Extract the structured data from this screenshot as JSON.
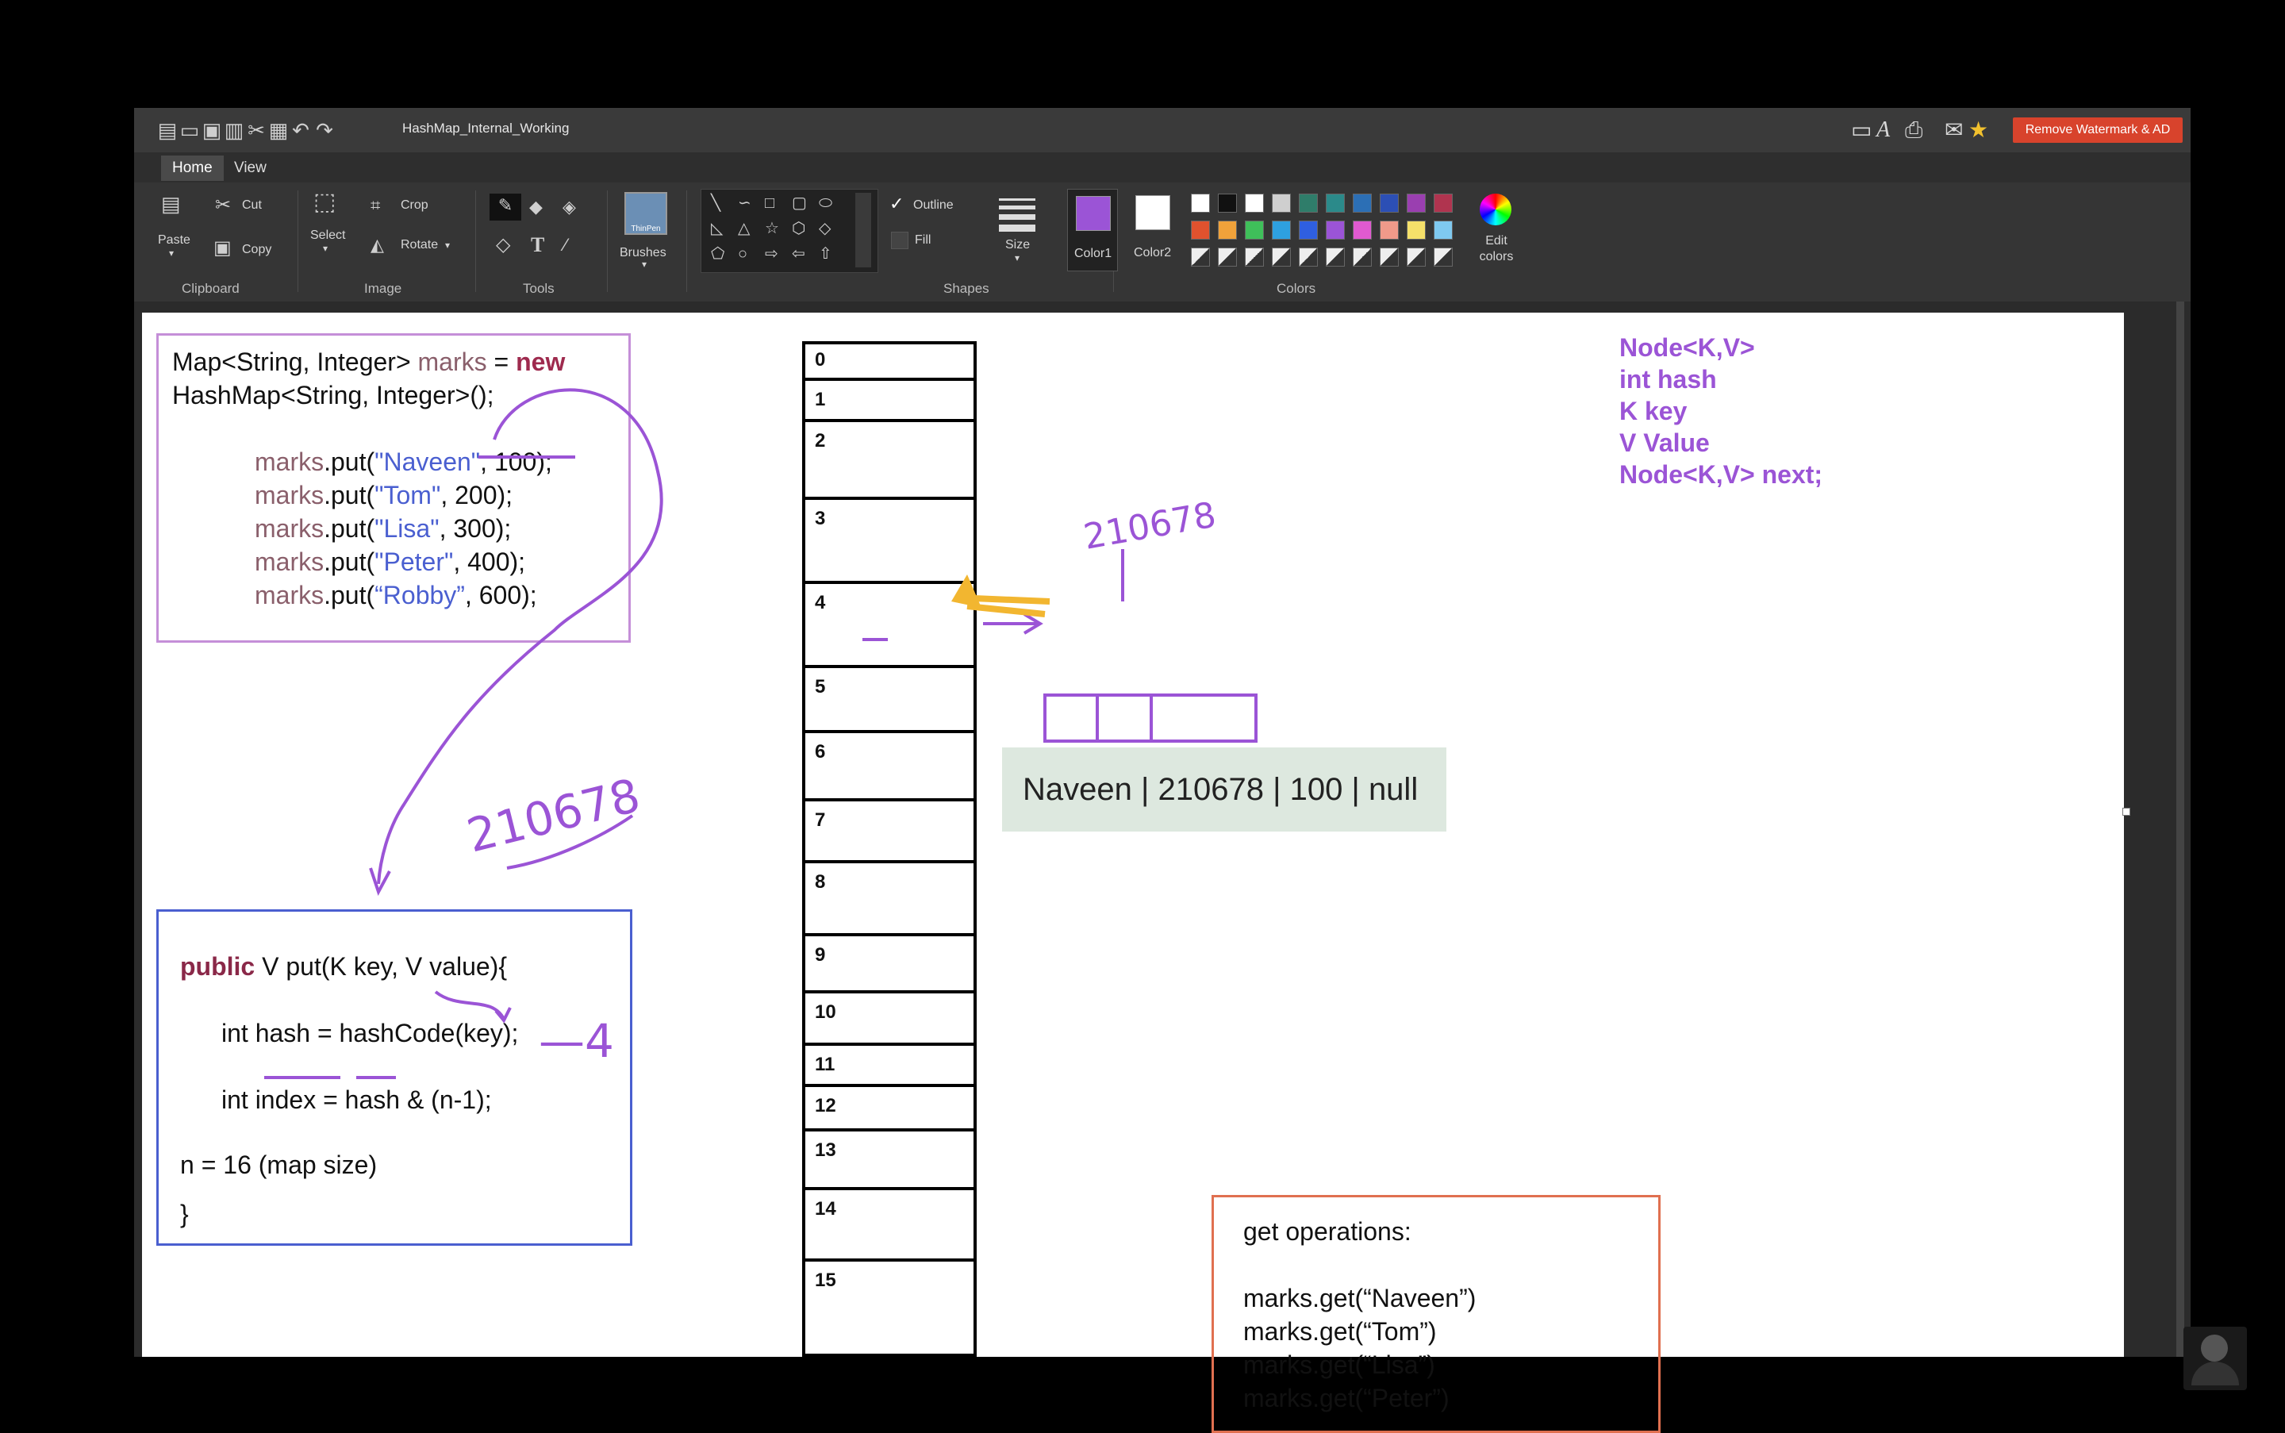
{
  "window": {
    "title": "HashMap_Internal_Working",
    "remove_watermark": "Remove Watermark & AD"
  },
  "tabs": [
    {
      "label": "Home",
      "active": true
    },
    {
      "label": "View",
      "active": false
    }
  ],
  "ribbon": {
    "clipboard": {
      "group": "Clipboard",
      "paste": "Paste",
      "cut": "Cut",
      "copy": "Copy"
    },
    "image": {
      "group": "Image",
      "select": "Select",
      "crop": "Crop",
      "rotate": "Rotate"
    },
    "tools": {
      "group": "Tools"
    },
    "brushes": {
      "label": "Brushes",
      "thumb": "ThinPen"
    },
    "shapes": {
      "group": "Shapes",
      "outline": "Outline",
      "fill": "Fill"
    },
    "size": {
      "label": "Size"
    },
    "colors": {
      "group": "Colors",
      "color1": "Color1",
      "color2": "Color2",
      "edit": "Edit colors",
      "color1_value": "#9b54d6",
      "color2_value": "#ffffff",
      "row1": [
        "#ffffff",
        "#111111",
        "#ffffff",
        "#cfcfcf",
        "#2f7d6a",
        "#2b8a8a",
        "#2c6fb5",
        "#2c4fb5",
        "#9a3fb0",
        "#b0344f"
      ],
      "row2": [
        "#e0522e",
        "#f0a23a",
        "#3fbf5a",
        "#2ea0e0",
        "#2f5fe0",
        "#9b54d6",
        "#e05ad0",
        "#f09a8a",
        "#f5e06a",
        "#7fc9f0"
      ]
    }
  },
  "code1": {
    "line1_a": "Map<String, Integer> ",
    "line1_b": "marks",
    "line1_c": " = ",
    "line1_d": "new",
    "line2": "HashMap<String, Integer>();",
    "puts": [
      {
        "obj": "marks",
        "pre": ".put(",
        "key": "\"Naveen\"",
        "post": ", 100);"
      },
      {
        "obj": "marks",
        "pre": ".put(",
        "key": "\"Tom\"",
        "post": ", 200);"
      },
      {
        "obj": "marks",
        "pre": ".put(",
        "key": "\"Lisa\"",
        "post": ", 300);"
      },
      {
        "obj": "marks",
        "pre": ".put(",
        "key": "\"Peter\"",
        "post": ", 400);"
      },
      {
        "obj": "marks",
        "pre": ".put(",
        "key": "“Robby”",
        "post": ", 600);"
      }
    ]
  },
  "code2": {
    "sig_kw": "public",
    "sig_rest": " V put(K key, V value){",
    "hash_line": "int hash = hashCode(key);",
    "index_line": "int index = hash & (n-1);",
    "n_line": "n = 16 (map size)",
    "close": "}"
  },
  "buckets": [
    "0",
    "1",
    "2",
    "3",
    "4",
    "5",
    "6",
    "7",
    "8",
    "9",
    "10",
    "11",
    "12",
    "13",
    "14",
    "15"
  ],
  "node_label": "Naveen | 210678 | 100 | null",
  "node_struct": [
    "Node<K,V>",
    "int hash",
    "K key",
    "V Value",
    "Node<K,V> next;"
  ],
  "get_ops": {
    "title": "get operations:",
    "lines": [
      "marks.get(“Naveen”)",
      "marks.get(“Tom”)",
      "marks.get(“Lisa”)",
      "marks.get(“Peter”)"
    ]
  },
  "annotations": {
    "hash_value": "210678",
    "index_value": "—4"
  }
}
